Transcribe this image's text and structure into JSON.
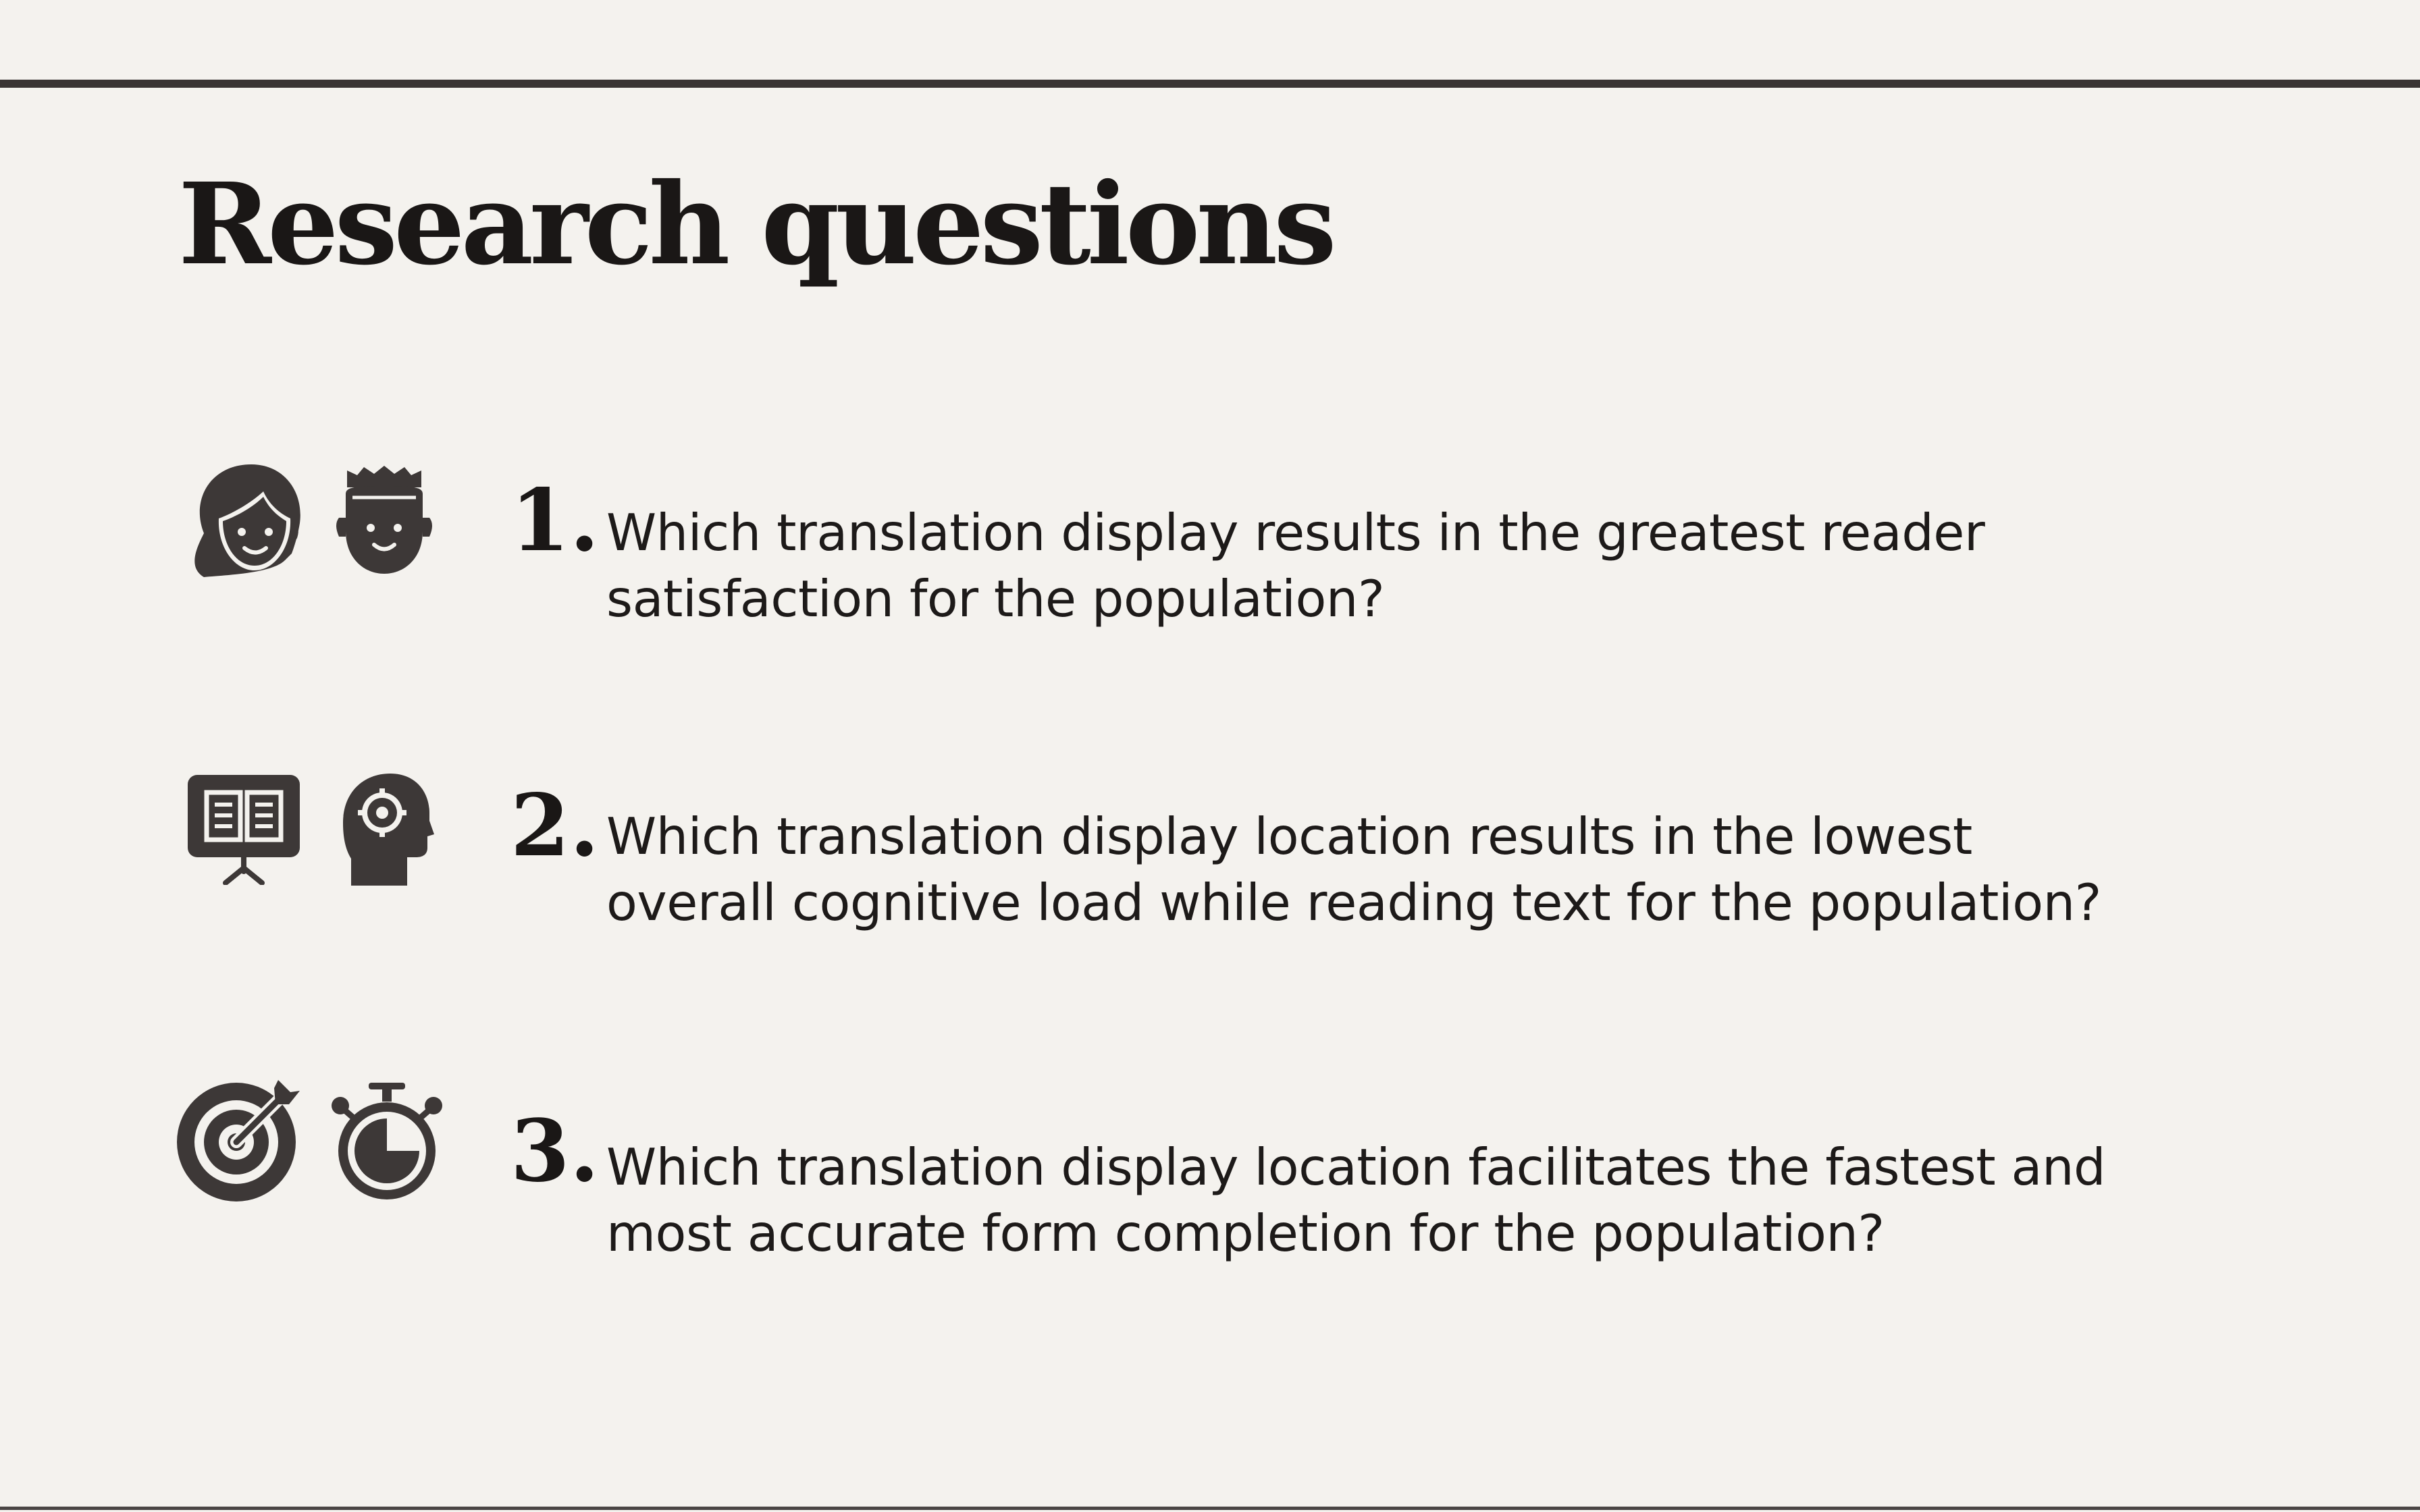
{
  "title": "Research questions",
  "colors": {
    "background": "#f4f2ee",
    "icon": "#3d3837",
    "text": "#1d1a19",
    "rule": "#3a3534"
  },
  "questions": [
    {
      "number": "1.",
      "line1": "Which translation display results in the greatest reader",
      "line2": "satisfaction for the population?",
      "icons": [
        "woman-face-icon",
        "man-face-icon"
      ]
    },
    {
      "number": "2.",
      "line1": "Which translation display location results in the lowest",
      "line2": "overall cognitive load while reading text for the population?",
      "icons": [
        "presentation-book-icon",
        "head-gear-icon"
      ]
    },
    {
      "number": "3.",
      "line1": "Which translation display location facilitates the fastest and",
      "line2": "most accurate form completion for the population?",
      "icons": [
        "target-arrow-icon",
        "stopwatch-icon"
      ]
    }
  ]
}
